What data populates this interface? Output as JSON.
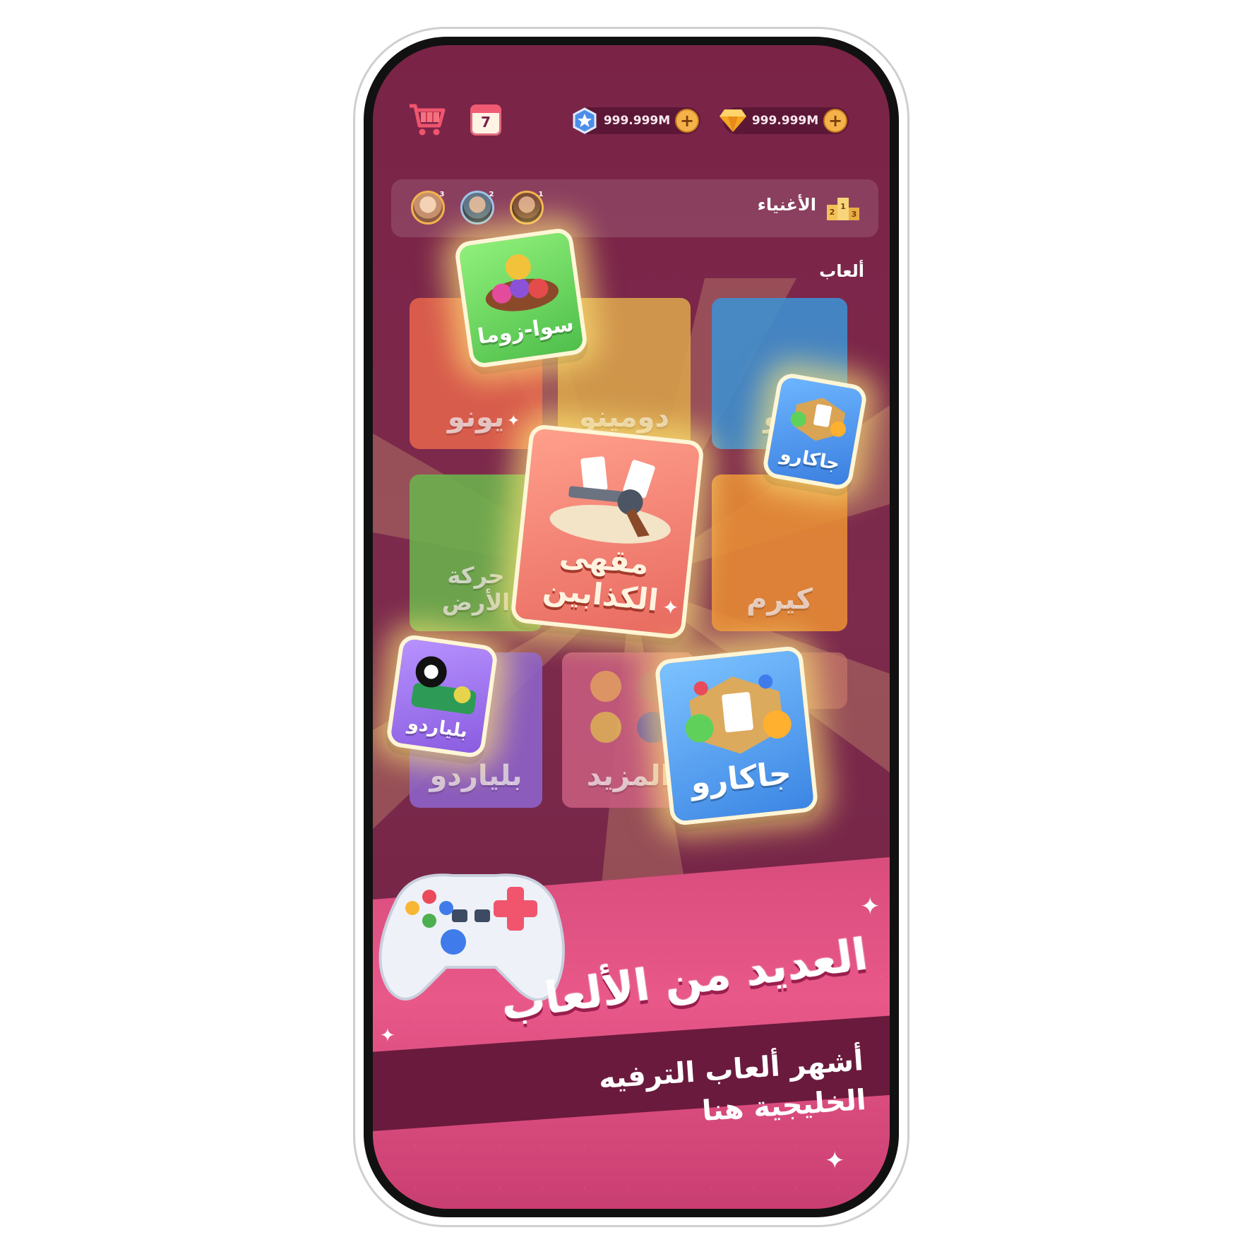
{
  "header": {
    "calendar_day": "7",
    "stars_amount": "999.999M",
    "gems_amount": "999.999M",
    "plus_label": "+"
  },
  "leaderboard": {
    "title": "الأغنياء",
    "ranks": [
      "3",
      "2",
      "1"
    ],
    "podium_digits": [
      "2",
      "1",
      "3"
    ]
  },
  "games_section": {
    "title": "ألعاب",
    "tiles": [
      {
        "label": "يونو",
        "color": "#e2624d"
      },
      {
        "label": "دومينو",
        "color": "#d9a24c"
      },
      {
        "label": "دو",
        "color": "#3f8fcf"
      },
      {
        "label": "حركة الأرض",
        "color": "#6bb04d"
      },
      {
        "label": "كيرم",
        "color": "#e78b35"
      },
      {
        "label": "بلياردو",
        "color": "#8d62c9"
      },
      {
        "label": "المزيد",
        "color": "#c65b7e"
      }
    ],
    "featured": [
      {
        "label": "سوا-زوما",
        "color": "#6fd25a"
      },
      {
        "label": "جاكارو",
        "color": "#3e8fe0"
      },
      {
        "label": "مقهى\nالكذابين",
        "color": "#f07e76"
      },
      {
        "label": "بلياردو",
        "color": "#9b6fe0"
      },
      {
        "label": "جاكارو",
        "color": "#3e8fe0"
      }
    ]
  },
  "promo": {
    "headline": "العديد من الألعاب",
    "subheadline_line1": "أشهر ألعاب الترفيه",
    "subheadline_line2": "الخليجية هنا"
  },
  "colors": {
    "background": "#7a2347",
    "accent_pink": "#e85889",
    "gold": "#f6b24a"
  },
  "icons": [
    "cart-icon",
    "calendar-icon",
    "star-badge-icon",
    "diamond-icon",
    "plus-icon",
    "podium-icon",
    "gamepad-icon",
    "sparkle-icon"
  ]
}
